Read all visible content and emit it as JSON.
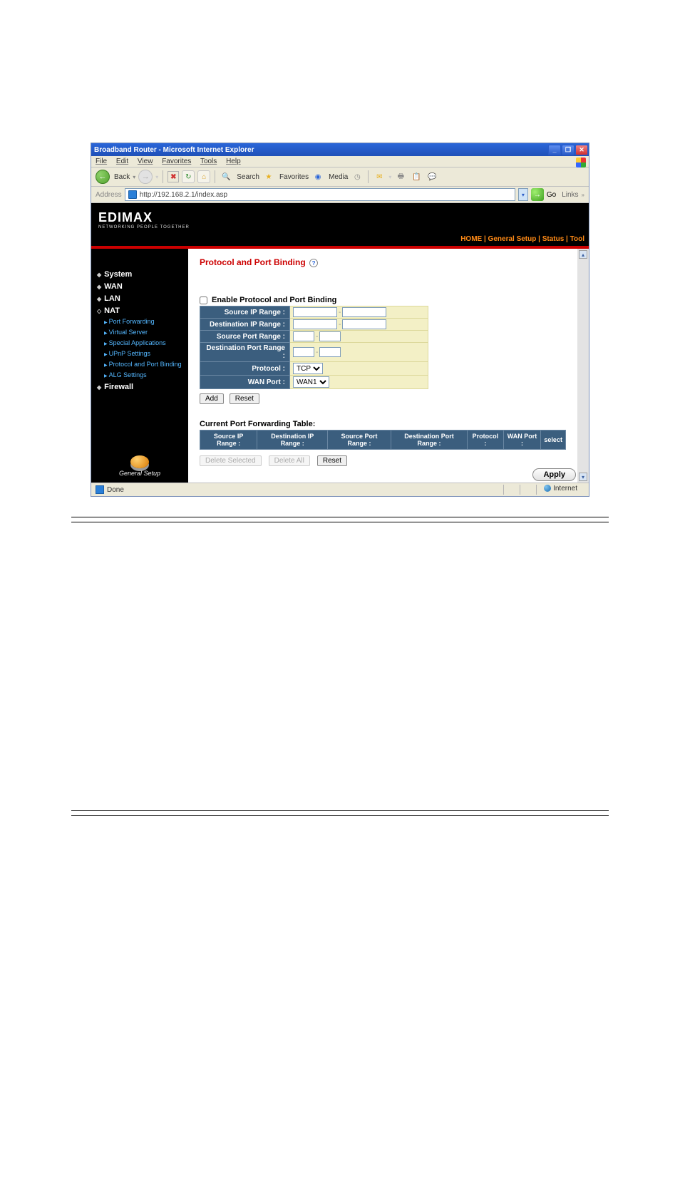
{
  "titlebar": {
    "title": "Broadband Router - Microsoft Internet Explorer"
  },
  "menubar": [
    "File",
    "Edit",
    "View",
    "Favorites",
    "Tools",
    "Help"
  ],
  "toolbar": {
    "back": "Back",
    "search": "Search",
    "favorites": "Favorites",
    "media": "Media"
  },
  "addressbar": {
    "label": "Address",
    "url": "http://192.168.2.1/index.asp",
    "go": "Go",
    "links": "Links"
  },
  "brand": {
    "name": "EDIMAX",
    "sub": "NETWORKING PEOPLE TOGETHER"
  },
  "toplinks": "HOME | General Setup | Status | Tool",
  "sidebar": {
    "items": [
      "System",
      "WAN",
      "LAN",
      "NAT"
    ],
    "sub": [
      "Port Forwarding",
      "Virtual Server",
      "Special Applications",
      "UPnP Settings",
      "Protocol and Port Binding",
      "ALG Settings"
    ],
    "firewall": "Firewall",
    "general": "General Setup"
  },
  "content": {
    "heading": "Protocol and Port Binding",
    "enable_label": "Enable Protocol and Port Binding",
    "rows": {
      "src_ip": "Source IP Range :",
      "dst_ip": "Destination IP Range :",
      "src_port": "Source Port Range :",
      "dst_port": "Destination Port Range :",
      "protocol": "Protocol :",
      "wan_port": "WAN Port :"
    },
    "protocol_value": "TCP",
    "wan_value": "WAN1",
    "add": "Add",
    "reset": "Reset",
    "table_label": "Current Port Forwarding Table:",
    "headers": {
      "c1": "Source IP Range :",
      "c2": "Destination IP Range :",
      "c3": "Source Port Range :",
      "c4": "Destination Port Range :",
      "c5": "Protocol :",
      "c6": "WAN Port :",
      "c7": "select"
    },
    "del_sel": "Delete Selected",
    "del_all": "Delete All",
    "reset2": "Reset",
    "apply": "Apply"
  },
  "statusbar": {
    "done": "Done",
    "internet": "Internet"
  }
}
